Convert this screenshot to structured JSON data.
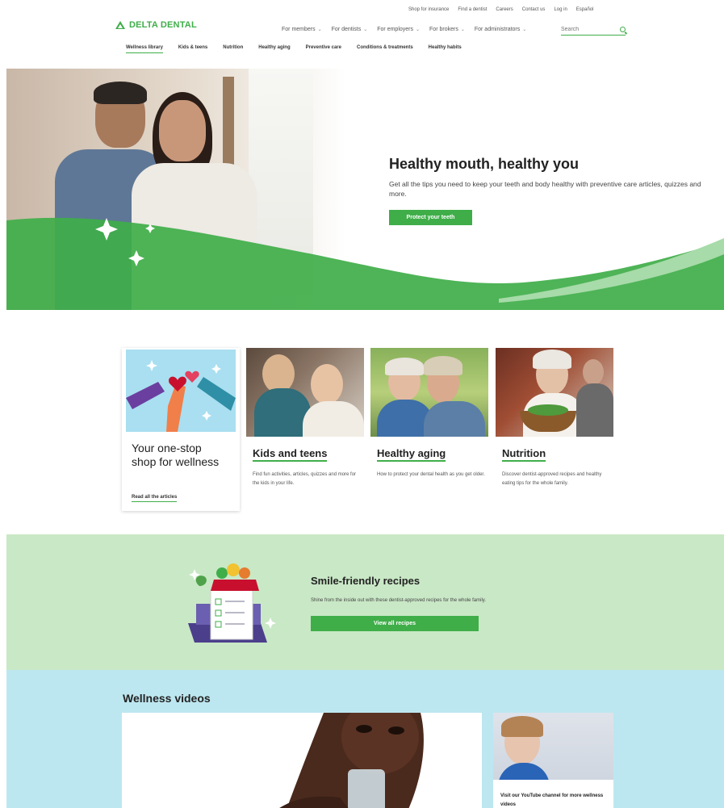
{
  "header": {
    "brand": "DELTA DENTAL",
    "utility_links": [
      "Shop for insurance",
      "Find a dentist",
      "Careers",
      "Contact us",
      "Log in",
      "Español"
    ],
    "main_nav": [
      "For members",
      "For dentists",
      "For employers",
      "For brokers",
      "For administrators"
    ],
    "search_placeholder": "Search",
    "sub_nav": [
      "Wellness library",
      "Kids & teens",
      "Nutrition",
      "Healthy aging",
      "Preventive care",
      "Conditions & treatments",
      "Healthy habits"
    ],
    "sub_nav_active": "Wellness library"
  },
  "hero": {
    "title": "Healthy mouth, healthy you",
    "subtitle": "Get all the tips you need to keep your teeth and body healthy with preventive care articles, quizzes and more.",
    "button": "Protect your teeth"
  },
  "cards": {
    "feature": {
      "title": "Your one-stop shop for wellness",
      "link": "Read all the articles"
    },
    "items": [
      {
        "title": "Kids and teens",
        "desc": "Find fun activities, articles, quizzes and more for the kids in your life."
      },
      {
        "title": "Healthy aging",
        "desc": "How to protect your dental health as you get older."
      },
      {
        "title": "Nutrition",
        "desc": "Discover dentist-approved recipes and healthy eating tips for the whole family."
      }
    ]
  },
  "recipes": {
    "title": "Smile-friendly recipes",
    "desc": "Shine from the inside out with these dentist-approved recipes for the whole family.",
    "button": "View all recipes"
  },
  "videos": {
    "title": "Wellness videos",
    "side_caption": "Visit our YouTube channel for more wellness videos"
  },
  "colors": {
    "brand_green": "#3fae49",
    "recipes_bg": "#c9e8c6",
    "videos_bg": "#bde7f0"
  }
}
